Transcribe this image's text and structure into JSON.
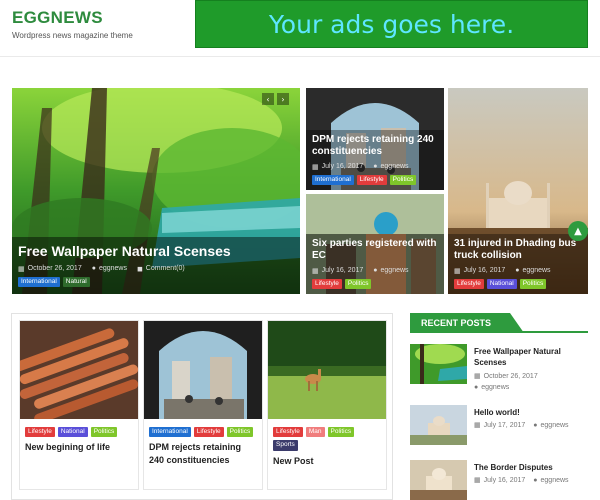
{
  "header": {
    "site_title": "EGGNEWS",
    "site_description": "Wordpress news magazine theme",
    "ad_text": "Your ads goes here."
  },
  "featured": {
    "main": {
      "title": "Free Wallpaper Natural Scenses",
      "date": "October 26, 2017",
      "author": "eggnews",
      "comments": "Comment(0)",
      "categories": [
        "International",
        "Natural"
      ]
    },
    "top_middle": {
      "title": "DPM rejects retaining 240 constituencies",
      "date": "July 16, 2017",
      "author": "eggnews",
      "categories": [
        "International",
        "Lifestyle",
        "Politics"
      ]
    },
    "bottom_middle": {
      "title": "Six parties registered with EC",
      "date": "July 16, 2017",
      "author": "eggnews",
      "categories": [
        "Lifestyle",
        "Politics"
      ]
    },
    "right": {
      "title": "31 injured in Dhading bus truck collision",
      "date": "July 16, 2017",
      "author": "eggnews",
      "categories": [
        "Lifestyle",
        "National",
        "Politics"
      ]
    }
  },
  "cards": [
    {
      "title": "New begining of life",
      "categories": [
        "Lifestyle",
        "National",
        "Politics"
      ]
    },
    {
      "title": "DPM rejects retaining 240 constituencies",
      "categories": [
        "International",
        "Lifestyle",
        "Politics"
      ]
    },
    {
      "title": "New Post",
      "categories": [
        "Lifestyle",
        "Man",
        "Politics",
        "Sports"
      ]
    }
  ],
  "recent_posts": {
    "heading": "RECENT POSTS",
    "items": [
      {
        "title": "Free Wallpaper Natural Scenses",
        "date": "October 26, 2017",
        "author": "eggnews"
      },
      {
        "title": "Hello world!",
        "date": "July 17, 2017",
        "author": "eggnews"
      },
      {
        "title": "The Border Disputes",
        "date": "July 16, 2017",
        "author": "eggnews"
      }
    ]
  },
  "colors": {
    "brand_green": "#2e9b3e",
    "ad_background": "#1f9b2a",
    "ad_text": "#5ee6ff"
  },
  "icons": [
    "calendar-icon",
    "user-icon",
    "comment-icon",
    "chevron-left-icon",
    "chevron-right-icon",
    "arrow-up-icon"
  ]
}
